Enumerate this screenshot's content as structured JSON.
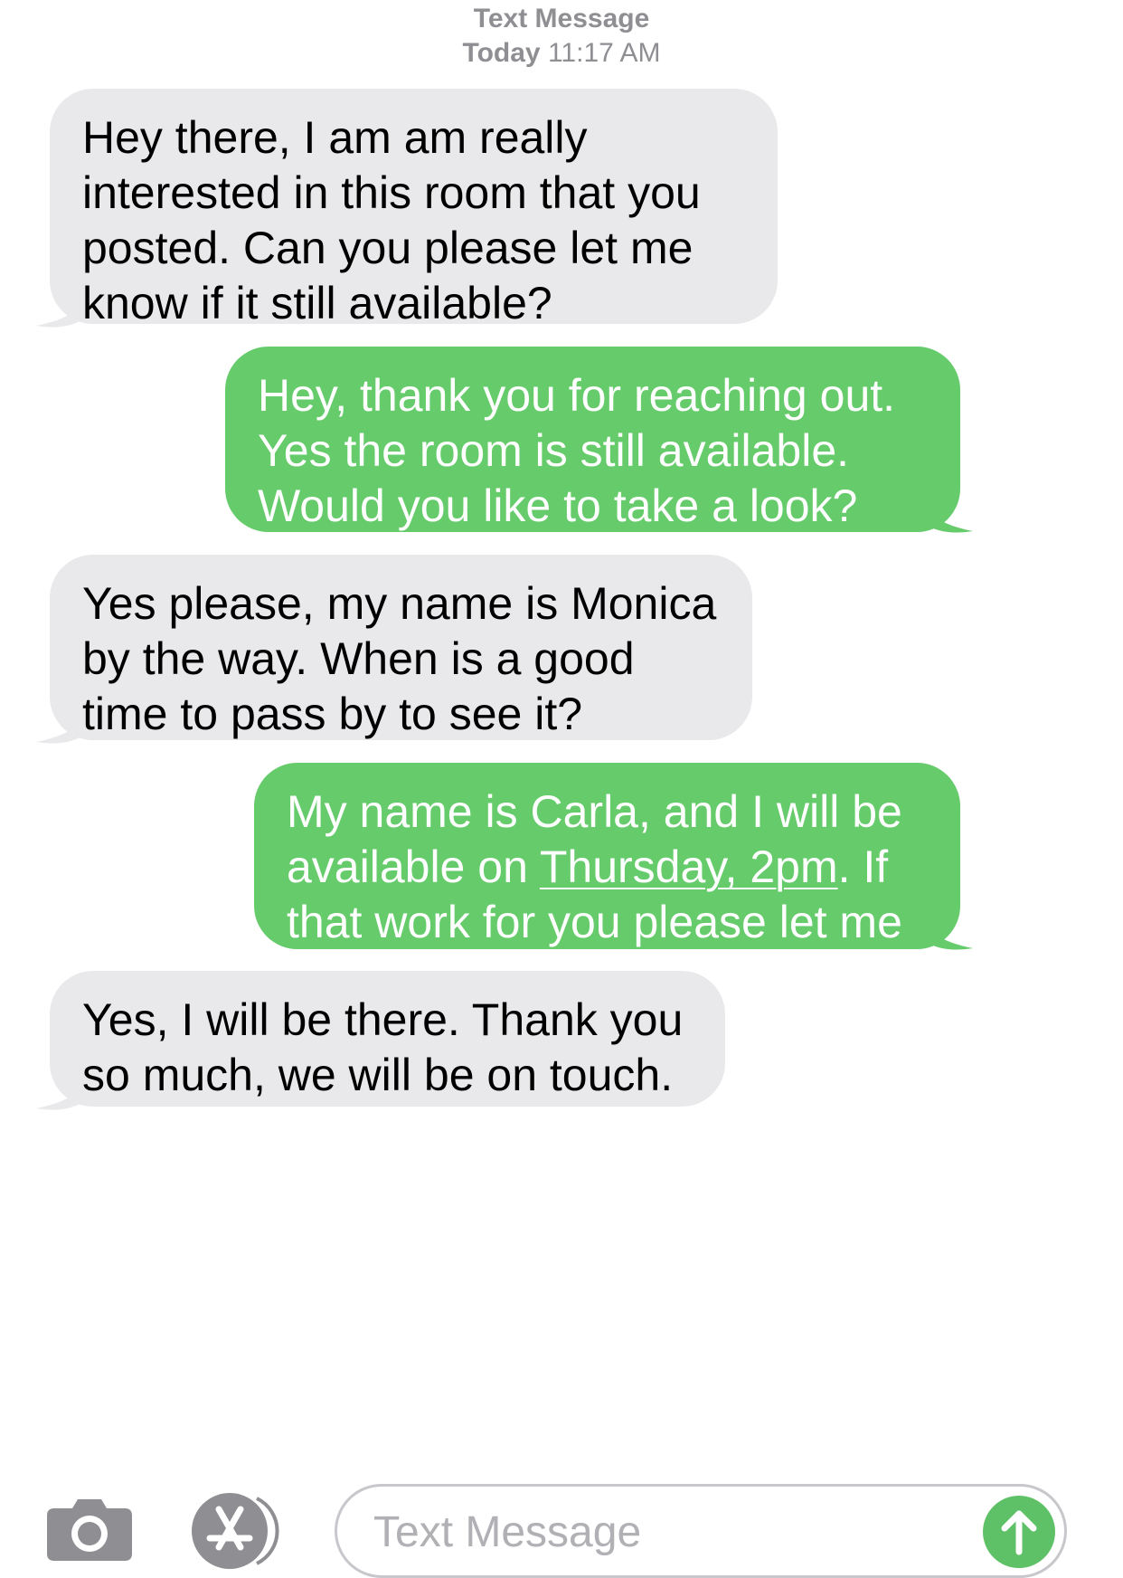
{
  "header": {
    "service": "Text Message",
    "day": "Today",
    "time": "11:17 AM"
  },
  "messages": [
    {
      "direction": "incoming",
      "text": "Hey there, I am am really interested in this room that you posted. Can you please let me know if it still available?"
    },
    {
      "direction": "outgoing",
      "text": "Hey, thank you for reaching out. Yes the room is still available. Would you like to take a look?"
    },
    {
      "direction": "incoming",
      "text": "Yes please, my name is Monica by the way. When is a good time to pass by to see it?"
    },
    {
      "direction": "outgoing",
      "text_before": "My name is Carla, and I will be available on ",
      "link_text": "Thursday, 2pm",
      "text_after": ". If that work for you please let me know."
    },
    {
      "direction": "incoming",
      "text": "Yes, I will be there. Thank you so much, we will be on touch."
    }
  ],
  "input": {
    "placeholder": "Text Message",
    "value": ""
  },
  "icons": {
    "camera": "camera-icon",
    "apps": "app-store-icon",
    "send": "send-arrow-icon"
  },
  "colors": {
    "incoming_bubble": "#e9e9eb",
    "outgoing_bubble": "#66cb6b",
    "meta_text": "#8e8e93",
    "send_button": "#5fc167"
  }
}
